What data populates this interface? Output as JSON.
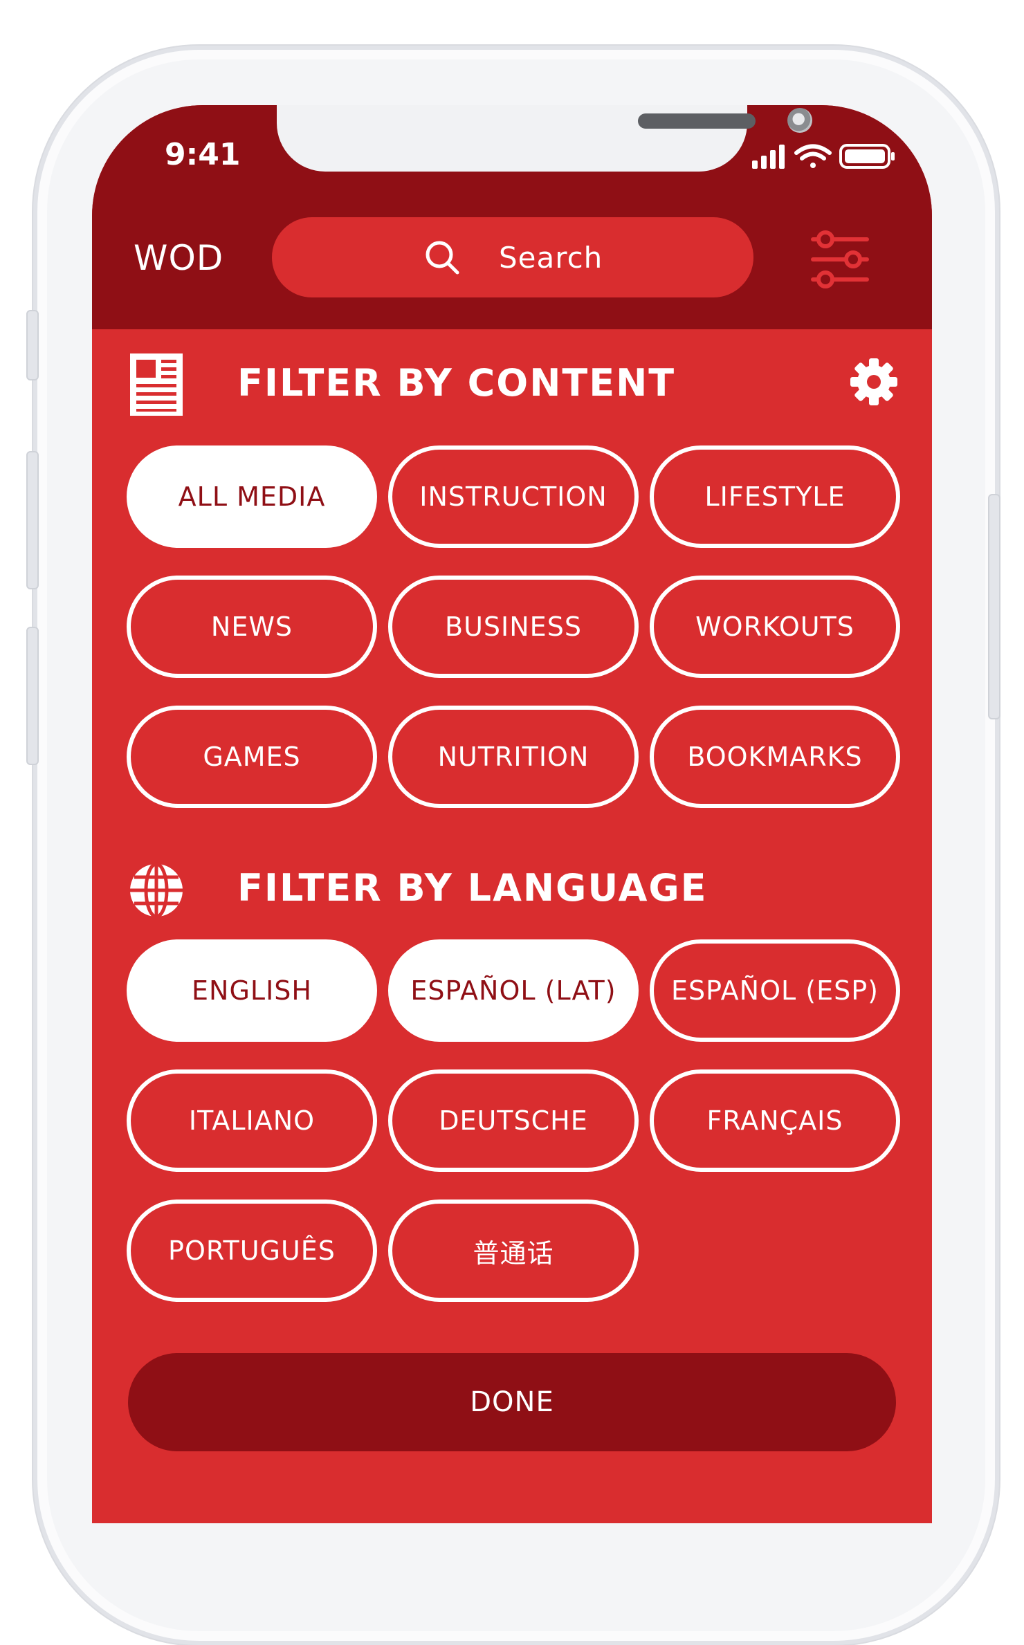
{
  "status_bar": {
    "time": "9:41",
    "icons": [
      "signal-icon",
      "wifi-icon",
      "battery-icon"
    ]
  },
  "header": {
    "app_title": "WOD",
    "search_placeholder": "Search",
    "icons": [
      "search-icon",
      "filter-sliders-icon"
    ]
  },
  "content_filter": {
    "title": "FILTER BY CONTENT",
    "icons": [
      "newspaper-icon",
      "gear-icon"
    ],
    "chips": [
      {
        "label": "ALL MEDIA",
        "selected": true
      },
      {
        "label": "INSTRUCTION",
        "selected": false
      },
      {
        "label": "LIFESTYLE",
        "selected": false
      },
      {
        "label": "NEWS",
        "selected": false
      },
      {
        "label": "BUSINESS",
        "selected": false
      },
      {
        "label": "WORKOUTS",
        "selected": false
      },
      {
        "label": "GAMES",
        "selected": false
      },
      {
        "label": "NUTRITION",
        "selected": false
      },
      {
        "label": "BOOKMARKS",
        "selected": false
      }
    ]
  },
  "language_filter": {
    "title": "FILTER BY LANGUAGE",
    "icons": [
      "globe-icon"
    ],
    "chips": [
      {
        "label": "ENGLISH",
        "selected": true
      },
      {
        "label": "ESPAÑOL (LAT)",
        "selected": true
      },
      {
        "label": "ESPAÑOL (ESP)",
        "selected": false
      },
      {
        "label": "ITALIANO",
        "selected": false
      },
      {
        "label": "DEUTSCHE",
        "selected": false
      },
      {
        "label": "FRANÇAIS",
        "selected": false
      },
      {
        "label": "PORTUGUÊS",
        "selected": false
      },
      {
        "label": "普通话",
        "selected": false
      }
    ]
  },
  "footer": {
    "done_label": "DONE"
  },
  "colors": {
    "header_bg": "#8f0f15",
    "body_bg": "#d92d2f",
    "chip_border": "#ffffff",
    "chip_selected_text": "#8f0f15"
  }
}
